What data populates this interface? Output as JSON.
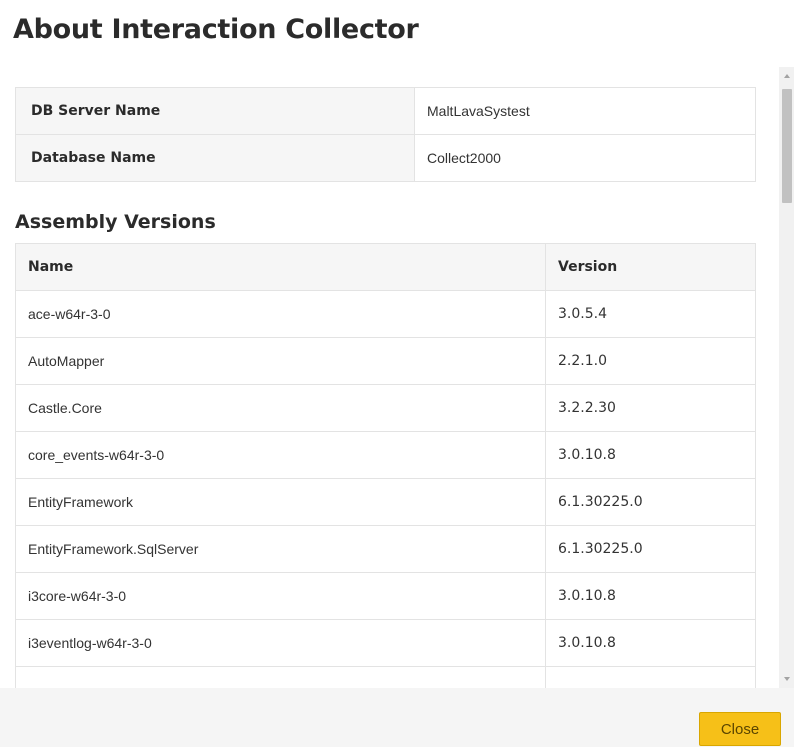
{
  "dialog": {
    "title": "About Interaction Collector",
    "close_label": "Close"
  },
  "db_info": [
    {
      "label": "DB Server Name",
      "value": "MaltLavaSystest"
    },
    {
      "label": "Database Name",
      "value": "Collect2000"
    }
  ],
  "assembly": {
    "heading": "Assembly Versions",
    "columns": {
      "name": "Name",
      "version": "Version"
    },
    "rows": [
      {
        "name": "ace-w64r-3-0",
        "version": "3.0.5.4"
      },
      {
        "name": "AutoMapper",
        "version": "2.2.1.0"
      },
      {
        "name": "Castle.Core",
        "version": "3.2.2.30"
      },
      {
        "name": "core_events-w64r-3-0",
        "version": "3.0.10.8"
      },
      {
        "name": "EntityFramework",
        "version": "6.1.30225.0"
      },
      {
        "name": "EntityFramework.SqlServer",
        "version": "6.1.30225.0"
      },
      {
        "name": "i3core-w64r-3-0",
        "version": "3.0.10.8"
      },
      {
        "name": "i3eventlog-w64r-3-0",
        "version": "3.0.10.8"
      },
      {
        "name": "",
        "version": ""
      }
    ]
  },
  "colors": {
    "accent_button": "#f6c018",
    "header_cell_bg": "#f6f6f6",
    "footer_bg": "#f5f5f5"
  }
}
